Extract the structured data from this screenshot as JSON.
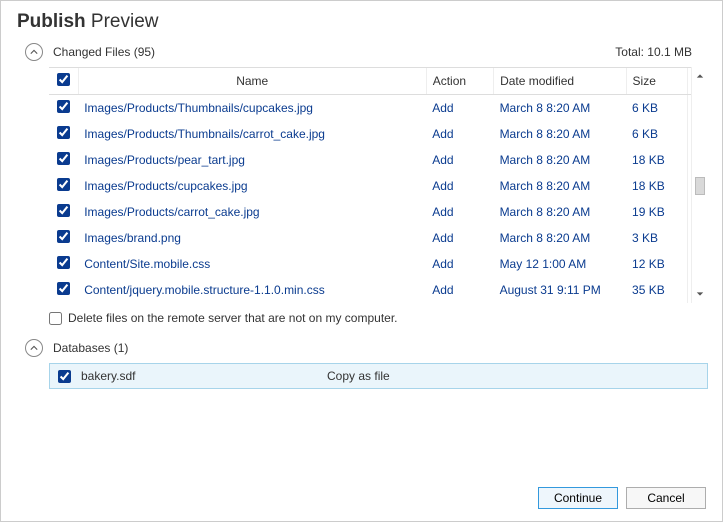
{
  "title_bold": "Publish",
  "title_rest": "Preview",
  "changed_files": {
    "label": "Changed Files (95)",
    "total": "Total: 10.1 MB",
    "headers": {
      "name": "Name",
      "action": "Action",
      "date": "Date modified",
      "size": "Size"
    },
    "rows": [
      {
        "name": "Images/Products/Thumbnails/cupcakes.jpg",
        "action": "Add",
        "date": "March 8 8:20 AM",
        "size": "6 KB"
      },
      {
        "name": "Images/Products/Thumbnails/carrot_cake.jpg",
        "action": "Add",
        "date": "March 8 8:20 AM",
        "size": "6 KB"
      },
      {
        "name": "Images/Products/pear_tart.jpg",
        "action": "Add",
        "date": "March 8 8:20 AM",
        "size": "18 KB"
      },
      {
        "name": "Images/Products/cupcakes.jpg",
        "action": "Add",
        "date": "March 8 8:20 AM",
        "size": "18 KB"
      },
      {
        "name": "Images/Products/carrot_cake.jpg",
        "action": "Add",
        "date": "March 8 8:20 AM",
        "size": "19 KB"
      },
      {
        "name": "Images/brand.png",
        "action": "Add",
        "date": "March 8 8:20 AM",
        "size": "3 KB"
      },
      {
        "name": "Content/Site.mobile.css",
        "action": "Add",
        "date": "May 12 1:00 AM",
        "size": "12 KB"
      },
      {
        "name": "Content/jquery.mobile.structure-1.1.0.min.css",
        "action": "Add",
        "date": "August 31 9:11 PM",
        "size": "35 KB"
      }
    ]
  },
  "delete_remote_label": "Delete files on the remote server that are not on my computer.",
  "databases": {
    "label": "Databases (1)",
    "rows": [
      {
        "name": "bakery.sdf",
        "action": "Copy as file"
      }
    ]
  },
  "buttons": {
    "continue": "Continue",
    "cancel": "Cancel"
  }
}
